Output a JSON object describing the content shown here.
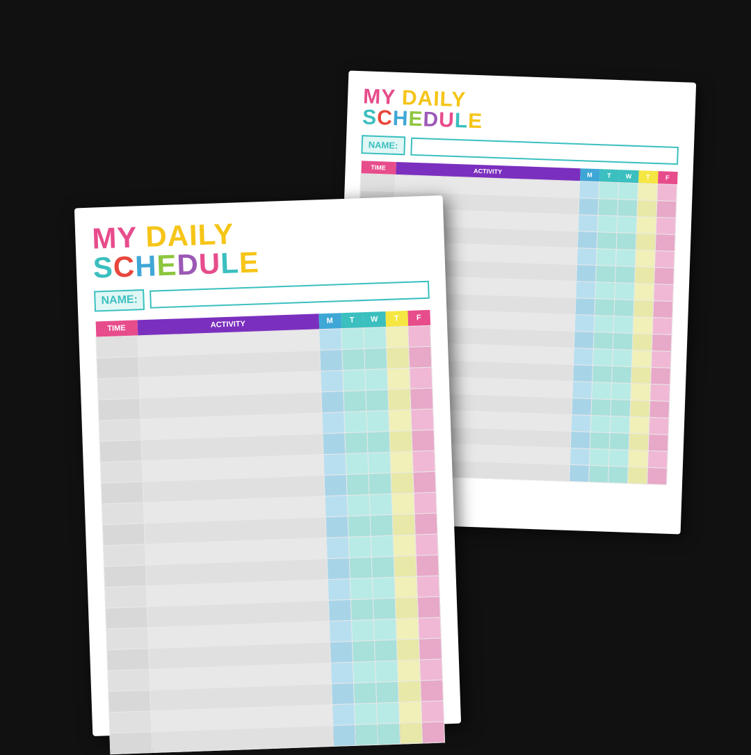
{
  "scene": {
    "background": "#111"
  },
  "card": {
    "title_line1": "MY DAILY",
    "title_line2": "SCHEDULE",
    "title_letters": [
      "S",
      "C",
      "H",
      "E",
      "D",
      "U",
      "L",
      "E"
    ],
    "name_label": "NAME:",
    "table_headers": {
      "time": "TIME",
      "activity": "ACTIVITY",
      "m": "M",
      "t": "T",
      "w": "W",
      "th": "T",
      "f": "F"
    },
    "row_count": 20
  }
}
